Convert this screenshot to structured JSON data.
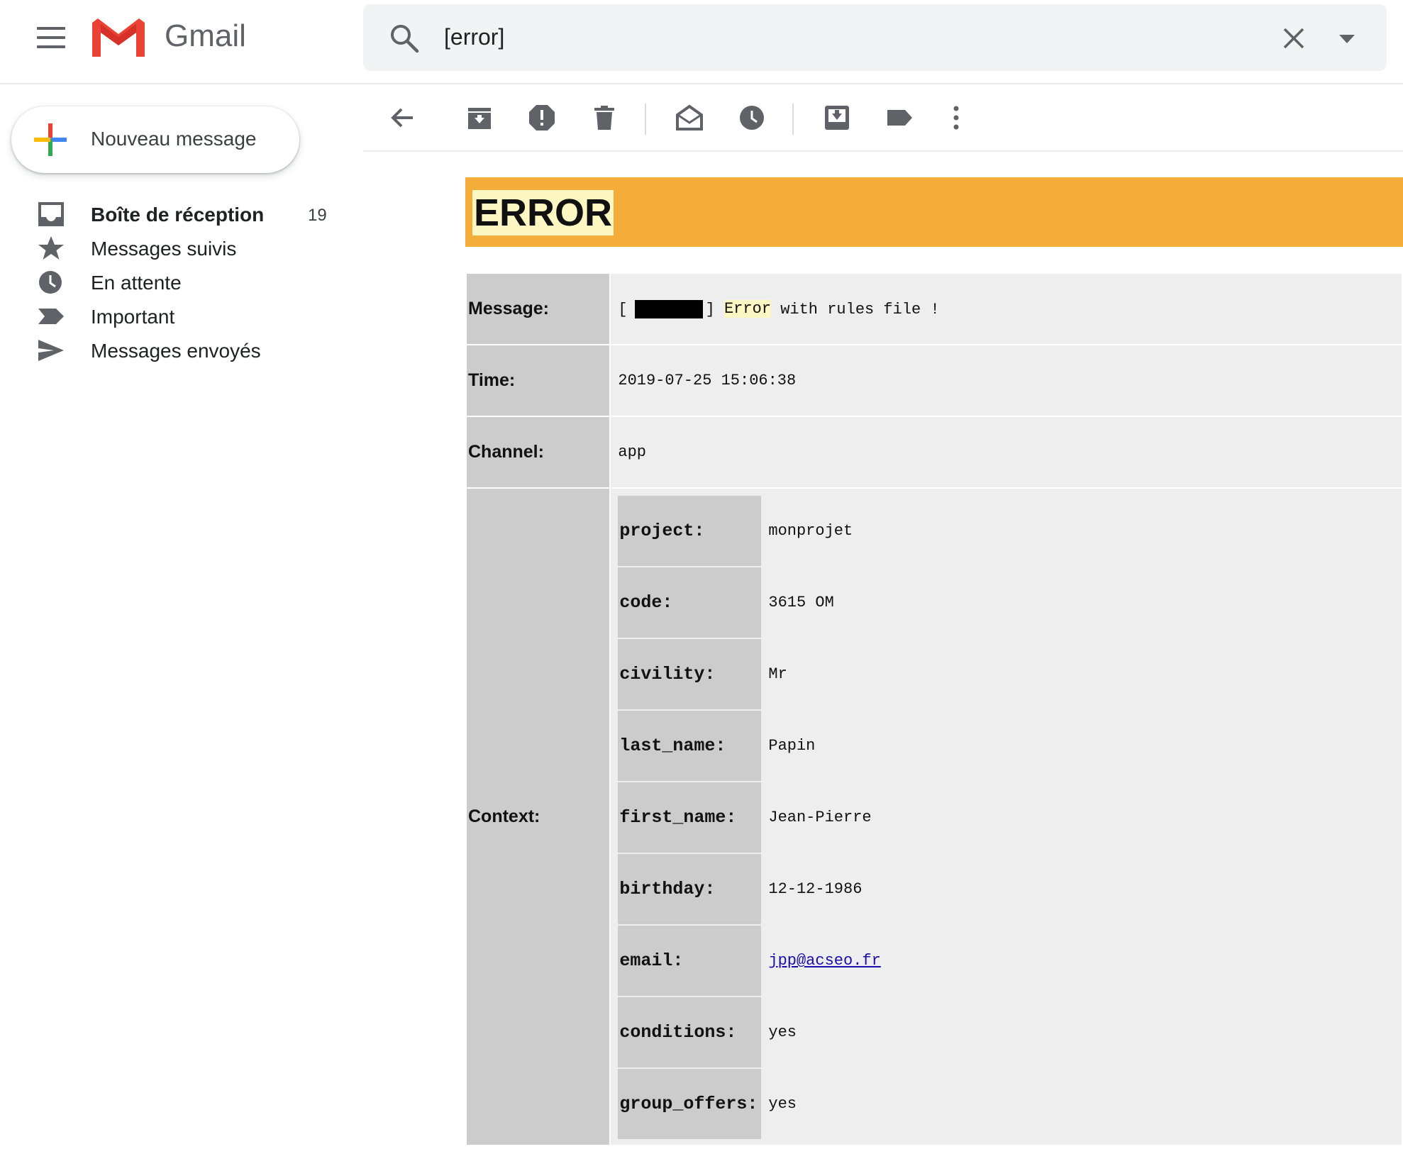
{
  "app": {
    "name": "Gmail"
  },
  "search": {
    "value": "[error]"
  },
  "compose": {
    "label": "Nouveau message"
  },
  "sidebar": {
    "items": [
      {
        "label": "Boîte de réception",
        "count": "19",
        "icon": "inbox-icon"
      },
      {
        "label": "Messages suivis",
        "icon": "star-icon"
      },
      {
        "label": "En attente",
        "icon": "clock-icon"
      },
      {
        "label": "Important",
        "icon": "important-icon"
      },
      {
        "label": "Messages envoyés",
        "icon": "send-icon"
      }
    ]
  },
  "toolbar": {
    "icons": [
      "back-arrow-icon",
      "archive-icon",
      "report-spam-icon",
      "delete-icon",
      "mark-unread-icon",
      "snooze-icon",
      "move-to-icon",
      "label-icon",
      "more-icon"
    ]
  },
  "email": {
    "banner_title": "ERROR",
    "rows": {
      "message_key": "Message:",
      "message_prefix": "[",
      "message_after_redaction": "]",
      "message_word": "Error",
      "message_rest": "with rules file !",
      "time_key": "Time:",
      "time_value": "2019-07-25 15:06:38",
      "channel_key": "Channel:",
      "channel_value": "app",
      "context_key": "Context:"
    },
    "context": [
      {
        "key": "project:",
        "value": "monprojet"
      },
      {
        "key": "code:",
        "value": "3615 OM"
      },
      {
        "key": "civility:",
        "value": "Mr"
      },
      {
        "key": "last_name:",
        "value": "Papin"
      },
      {
        "key": "first_name:",
        "value": "Jean-Pierre"
      },
      {
        "key": "birthday:",
        "value": "12-12-1986"
      },
      {
        "key": "email:",
        "value": "jpp@acseo.fr"
      },
      {
        "key": "conditions:",
        "value": "yes"
      },
      {
        "key": "group_offers:",
        "value": "yes"
      }
    ]
  },
  "colors": {
    "banner": "#f5ad3a",
    "highlight": "#fdf7c3",
    "key_cell": "#cccccc",
    "value_cell": "#eeeeee",
    "gmail_red": "#ea4335"
  }
}
